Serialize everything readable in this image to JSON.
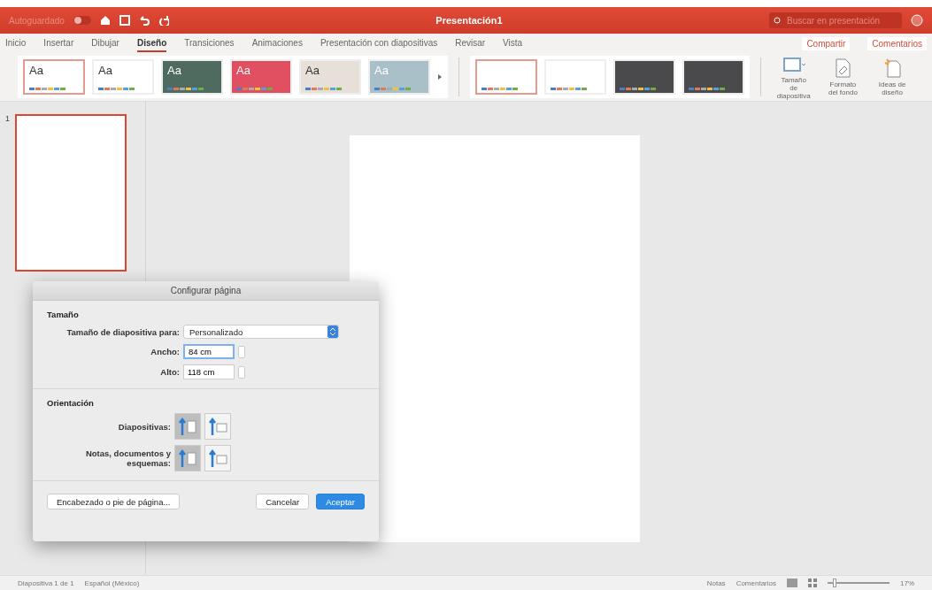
{
  "title_bar": {
    "autosave": {
      "label": "Autoguardado",
      "on": false
    },
    "title": "Presentación1",
    "search": {
      "placeholder": "Buscar en presentación"
    }
  },
  "tabs": [
    {
      "label": "Inicio",
      "selected": false
    },
    {
      "label": "Insertar",
      "selected": false
    },
    {
      "label": "Dibujar",
      "selected": false
    },
    {
      "label": "Diseño",
      "selected": true
    },
    {
      "label": "Transiciones",
      "selected": false
    },
    {
      "label": "Animaciones",
      "selected": false
    },
    {
      "label": "Presentación con diapositivas",
      "selected": false
    },
    {
      "label": "Revisar",
      "selected": false
    },
    {
      "label": "Vista",
      "selected": false
    }
  ],
  "actions": {
    "share": "Compartir",
    "comments": "Comentarios"
  },
  "themes": [
    {
      "sample": "Aa",
      "color": "#ffffff",
      "selected": true
    },
    {
      "sample": "Aa",
      "color": "#ffffff",
      "selected": false
    },
    {
      "sample": "Aa",
      "color": "#4f6b5f",
      "selected": false
    },
    {
      "sample": "Aa",
      "color": "#e05060",
      "selected": false
    },
    {
      "sample": "Aa",
      "color": "#e6e0d8",
      "selected": false
    },
    {
      "sample": "Aa",
      "color": "#a9c0c8",
      "selected": false
    }
  ],
  "variants": [
    {
      "color": "#ffffff",
      "selected": true
    },
    {
      "color": "#ffffff",
      "selected": false
    },
    {
      "color": "#4a4a4c",
      "selected": false
    },
    {
      "color": "#4a4a4c",
      "selected": false
    }
  ],
  "ribbon_buttons": [
    {
      "label": "Tamaño de diapositiva",
      "kind": "size"
    },
    {
      "label": "Formato del fondo",
      "kind": "format"
    },
    {
      "label": "Ideas de diseño",
      "kind": "ideas"
    }
  ],
  "slides": [
    {
      "number": "1",
      "selected": true
    }
  ],
  "dialog": {
    "title": "Configurar página",
    "size_section": "Tamaño",
    "slide_size": {
      "label": "Tamaño de diapositiva para:",
      "value": "Personalizado"
    },
    "width": {
      "label": "Ancho:",
      "value": "84 cm",
      "focused": true
    },
    "height": {
      "label": "Alto:",
      "value": "118 cm",
      "focused": false
    },
    "orientation_section": "Orientación",
    "orientations": [
      {
        "label": "Diapositivas:",
        "options": [
          {
            "kind": "portrait",
            "selected": true
          },
          {
            "kind": "landscape",
            "selected": false
          }
        ]
      },
      {
        "label": "Notas, documentos y esquemas:",
        "options": [
          {
            "kind": "portrait",
            "selected": true
          },
          {
            "kind": "landscape",
            "selected": false
          }
        ]
      }
    ],
    "header_footer": "Encabezado o pie de página...",
    "cancel": "Cancelar",
    "ok": "Aceptar"
  },
  "status_bar": {
    "slide": "Diapositiva 1 de 1",
    "language": "Español (México)",
    "notes": "Notas",
    "comments": "Comentarios",
    "zoom": {
      "level": 0.08,
      "reading": "17%"
    }
  }
}
